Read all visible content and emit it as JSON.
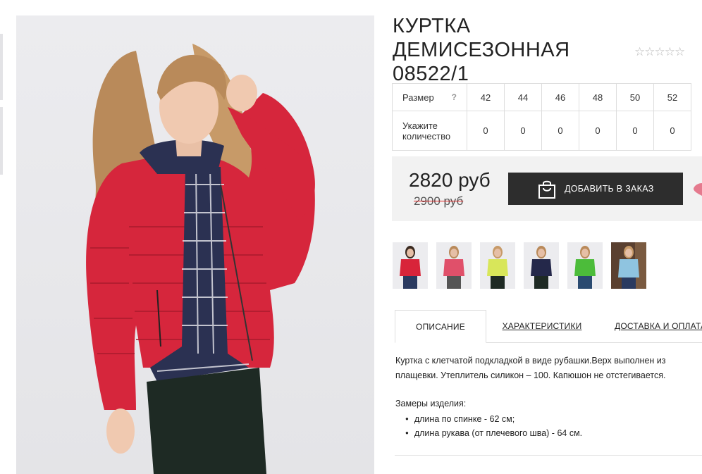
{
  "product": {
    "title": "КУРТКА ДЕМИСЕЗОННАЯ 08522/1",
    "rating": "☆☆☆☆☆",
    "main_image_alt": "Model wearing red quilted jacket with plaid hood lining",
    "accent_color": "#d6263c"
  },
  "sizes": {
    "size_label": "Размер",
    "help_icon": "?",
    "quantity_label": "Укажите количество",
    "items": [
      {
        "size": "42",
        "qty": "0"
      },
      {
        "size": "44",
        "qty": "0"
      },
      {
        "size": "46",
        "qty": "0"
      },
      {
        "size": "48",
        "qty": "0"
      },
      {
        "size": "50",
        "qty": "0"
      },
      {
        "size": "52",
        "qty": "0"
      }
    ]
  },
  "price": {
    "current": "2820 руб",
    "old": "2900 руб",
    "add_button": "ДОБАВИТЬ В ЗАКАЗ",
    "button_color": "#2d2d2d"
  },
  "color_variants": [
    {
      "name": "red",
      "color": "#d8243a"
    },
    {
      "name": "pink-red",
      "color": "#e0506a"
    },
    {
      "name": "lime",
      "color": "#d8e65a"
    },
    {
      "name": "navy",
      "color": "#24284a"
    },
    {
      "name": "green",
      "color": "#4cbc3a"
    },
    {
      "name": "light-blue",
      "color": "#8fc4e0"
    }
  ],
  "tabs": {
    "description": "ОПИСАНИЕ",
    "characteristics": "ХАРАКТЕРИСТИКИ",
    "delivery": "ДОСТАВКА И ОПЛАТА"
  },
  "description": {
    "text": "Куртка с клетчатой подкладкой в виде рубашки.Верх выполнен из плащевки. Утеплитель силикон – 100. Капюшон не отстегивается.",
    "measures_title": "Замеры изделия:",
    "measures": [
      "длина по спинке - 62 см;",
      "длина рукава (от плечевого шва) - 64 см."
    ]
  }
}
